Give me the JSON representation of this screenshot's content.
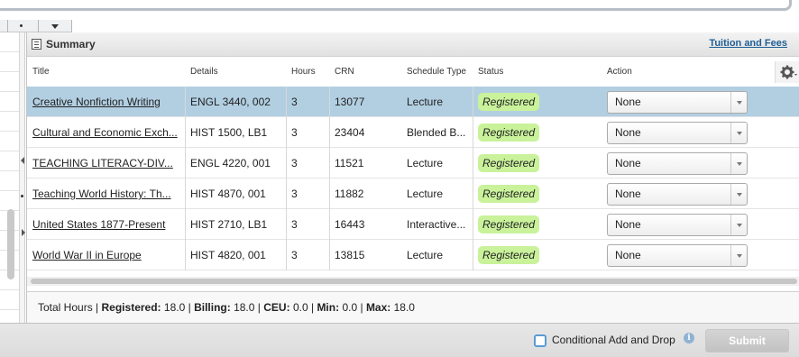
{
  "panel": {
    "title": "Summary",
    "tuition_link": "Tuition and Fees"
  },
  "columns": {
    "title": "Title",
    "details": "Details",
    "hours": "Hours",
    "crn": "CRN",
    "schedule_type": "Schedule Type",
    "status": "Status",
    "action": "Action"
  },
  "rows": [
    {
      "title": "Creative Nonfiction Writing",
      "details": "ENGL 3440, 002",
      "hours": "3",
      "crn": "13077",
      "schedule_type": "Lecture",
      "status": "Registered",
      "action": "None"
    },
    {
      "title": "Cultural and Economic Exch...",
      "details": "HIST 1500, LB1",
      "hours": "3",
      "crn": "23404",
      "schedule_type": "Blended B...",
      "status": "Registered",
      "action": "None"
    },
    {
      "title": "TEACHING LITERACY-DIV...",
      "details": "ENGL 4220, 001",
      "hours": "3",
      "crn": "11521",
      "schedule_type": "Lecture",
      "status": "Registered",
      "action": "None"
    },
    {
      "title": "Teaching World History: Th...",
      "details": "HIST 4870, 001",
      "hours": "3",
      "crn": "11882",
      "schedule_type": "Lecture",
      "status": "Registered",
      "action": "None"
    },
    {
      "title": "United States 1877-Present",
      "details": "HIST 2710, LB1",
      "hours": "3",
      "crn": "16443",
      "schedule_type": "Interactive...",
      "status": "Registered",
      "action": "None"
    },
    {
      "title": "World War II in Europe",
      "details": "HIST 4820, 001",
      "hours": "3",
      "crn": "13815",
      "schedule_type": "Lecture",
      "status": "Registered",
      "action": "None"
    }
  ],
  "totals": {
    "total_hours_label": "Total Hours",
    "registered_label": "Registered:",
    "registered_value": "18.0",
    "billing_label": "Billing:",
    "billing_value": "18.0",
    "ceu_label": "CEU:",
    "ceu_value": "0.0",
    "min_label": "Min:",
    "min_value": "0.0",
    "max_label": "Max:",
    "max_value": "18.0",
    "sep": "|"
  },
  "footer": {
    "conditional_label": "Conditional Add and Drop",
    "info_glyph": "i",
    "submit_label": "Submit"
  },
  "colors": {
    "selected_row": "#b2cfe2",
    "badge": "#c9f29b",
    "link": "#1f5f94"
  }
}
